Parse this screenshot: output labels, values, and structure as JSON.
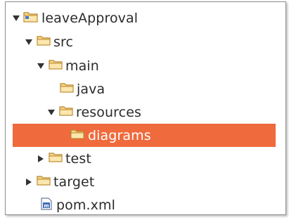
{
  "tree": {
    "items": [
      {
        "label": "leaveApproval",
        "icon": "project-folder-icon",
        "expanded": true,
        "level": 0
      },
      {
        "label": "src",
        "icon": "folder-icon",
        "expanded": true,
        "level": 1
      },
      {
        "label": "main",
        "icon": "folder-icon",
        "expanded": true,
        "level": 2
      },
      {
        "label": "java",
        "icon": "folder-icon",
        "expanded": null,
        "level": 3
      },
      {
        "label": "resources",
        "icon": "folder-icon",
        "expanded": true,
        "level": 3
      },
      {
        "label": "diagrams",
        "icon": "folder-icon",
        "selected": true,
        "level": 4
      },
      {
        "label": "test",
        "icon": "folder-icon",
        "expanded": false,
        "level": 2
      },
      {
        "label": "target",
        "icon": "folder-icon",
        "expanded": false,
        "level": 1
      },
      {
        "label": "pom.xml",
        "icon": "maven-file-icon",
        "level": 1
      }
    ]
  },
  "colors": {
    "selection": "#ef6a3c",
    "folder_fill": "#f6d58a",
    "folder_stroke": "#b8862b"
  }
}
